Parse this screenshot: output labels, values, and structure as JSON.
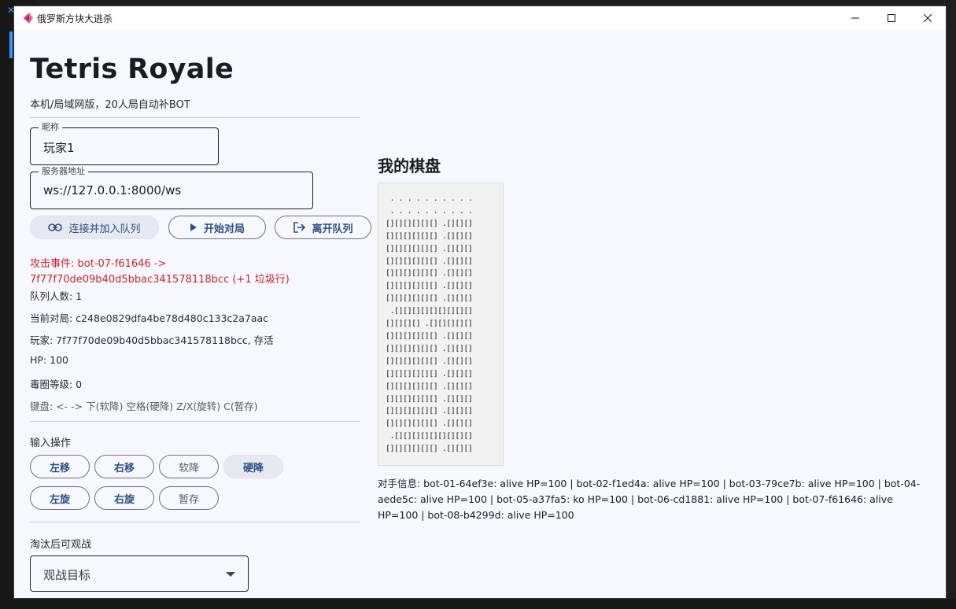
{
  "window": {
    "title": "俄罗斯方块大逃杀"
  },
  "header": {
    "title": "Tetris Royale",
    "subtitle": "本机/局域网版，20人局自动补BOT"
  },
  "form": {
    "nickname": {
      "label": "昵称",
      "value": "玩家1"
    },
    "server": {
      "label": "服务器地址",
      "value": "ws://127.0.0.1:8000/ws"
    }
  },
  "actions": {
    "join": "连接并加入队列",
    "start": "开始对局",
    "leave": "离开队列"
  },
  "status": {
    "attack_event": "攻击事件: bot-07-f61646 -> 7f77f70de09b40d5bbac341578118bcc (+1 垃圾行)",
    "queue_count": "队列人数: 1",
    "current_match": "当前对局: c248e0829dfa4be78d480c133c2a7aac",
    "player": "玩家: 7f77f70de09b40d5bbac341578118bcc, 存活",
    "hp": "HP: 100",
    "poison_level": "毒圈等级: 0",
    "keyboard_help": "键盘: <- -> 下(软降) 空格(硬降) Z/X(旋转) C(暂存)"
  },
  "input_ops": {
    "label": "输入操作",
    "left": "左移",
    "right": "右移",
    "soft_drop": "软降",
    "hard_drop": "硬降",
    "rotate_left": "左旋",
    "rotate_right": "右旋",
    "hold": "暂存"
  },
  "spectate": {
    "label": "淘汰后可观战",
    "placeholder": "观战目标"
  },
  "board": {
    "title": "我的棋盘",
    "rows": [
      " . . . . . . . . . .",
      " . . . . . . . . . .",
      "[][][][][][] .[][][]",
      "[][][][][][] .[][][]",
      "[][][][][][] .[][][]",
      "[][][][][][] .[][][]",
      "[][][][][][] .[][][]",
      "[][][][][][] .[][][]",
      "[][][][][][] .[][][]",
      " .[][][][][][][][][]",
      "[][][][] .[][][][][]",
      "[][][][][][] .[][][]",
      "[][][][][][] .[][][]",
      "[][][][][][] .[][][]",
      "[][][][][][] .[][][]",
      "[][][][][][] .[][][]",
      "[][][][][][] .[][][]",
      "[][][][][][] .[][][]",
      "[][][][][][] .[][][]",
      " .[][][][][][][][][]",
      "[][][][][][] .[][][]"
    ]
  },
  "opponents": {
    "text": "对手信息: bot-01-64ef3e: alive HP=100 | bot-02-f1ed4a: alive HP=100 | bot-03-79ce7b: alive HP=100 | bot-04-aede5c: alive HP=100 | bot-05-a37fa5: ko HP=100 | bot-06-cd1881: alive HP=100 | bot-07-f61646: alive HP=100 | bot-08-b4299d: alive HP=100"
  },
  "colors": {
    "accent": "#2d4f80",
    "error": "#c62828",
    "background": "#f7f8fd"
  }
}
